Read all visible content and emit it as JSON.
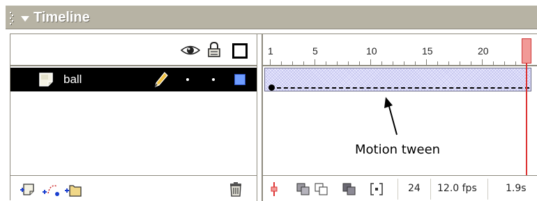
{
  "title": "Timeline",
  "layer": {
    "name": "ball",
    "color": "#6f9dff"
  },
  "ruler": {
    "labels": [
      "1",
      "5",
      "10",
      "15",
      "20",
      "2"
    ]
  },
  "annotation": "Motion tween",
  "status": {
    "current_frame": "24",
    "frame_rate": "12.0 fps",
    "elapsed_time": "1.9s"
  },
  "icons": {
    "titlebar": [
      "grip-icon",
      "collapse-arrow-icon"
    ],
    "layer_header": [
      "eye-icon",
      "lock-icon",
      "outline-icon"
    ],
    "layer_row": [
      "layer-icon",
      "pencil-icon"
    ],
    "layer_footer": [
      "insert-layer-icon",
      "add-motion-guide-icon",
      "insert-layer-folder-icon",
      "trash-icon"
    ],
    "frame_footer": [
      "center-frame-icon",
      "onion-skin-icon",
      "onion-skin-outlines-icon",
      "edit-multiple-frames-icon",
      "modify-onion-markers-icon"
    ]
  }
}
